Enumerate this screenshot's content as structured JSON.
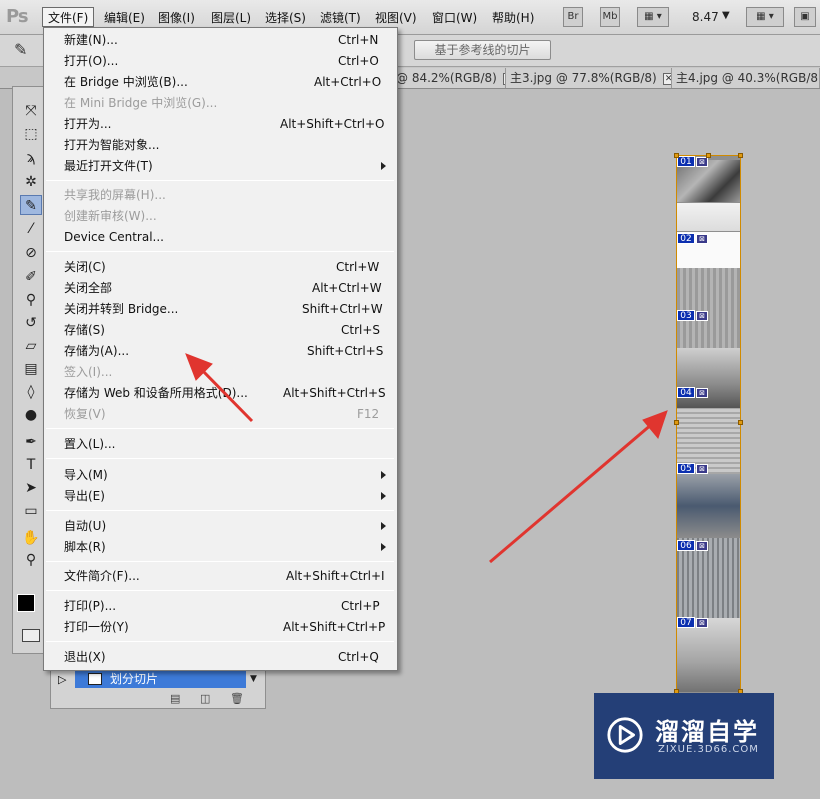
{
  "app": {
    "logo": "Ps"
  },
  "menubar": {
    "items": [
      {
        "label": "文件(F)"
      },
      {
        "label": "编辑(E)"
      },
      {
        "label": "图像(I)"
      },
      {
        "label": "图层(L)"
      },
      {
        "label": "选择(S)"
      },
      {
        "label": "滤镜(T)"
      },
      {
        "label": "视图(V)"
      },
      {
        "label": "窗口(W)"
      },
      {
        "label": "帮助(H)"
      }
    ],
    "bridge_btn": "Br",
    "minibridge_btn": "Mb",
    "zoom": "8.47"
  },
  "options": {
    "slice_from_guides": "基于参考线的切片"
  },
  "tabs": [
    {
      "label": "@ 84.2%(RGB/8)"
    },
    {
      "label": "主3.jpg @ 77.8%(RGB/8)"
    },
    {
      "label": "主4.jpg @ 40.3%(RGB/8)"
    }
  ],
  "file_menu": {
    "items": [
      {
        "label": "新建(N)...",
        "shortcut": "Ctrl+N"
      },
      {
        "label": "打开(O)...",
        "shortcut": "Ctrl+O"
      },
      {
        "label": "在 Bridge 中浏览(B)...",
        "shortcut": "Alt+Ctrl+O"
      },
      {
        "label": "在 Mini Bridge 中浏览(G)...",
        "shortcut": ""
      },
      {
        "label": "打开为...",
        "shortcut": "Alt+Shift+Ctrl+O"
      },
      {
        "label": "打开为智能对象...",
        "shortcut": ""
      },
      {
        "label": "最近打开文件(T)",
        "shortcut": ""
      },
      {
        "label": "共享我的屏幕(H)...",
        "shortcut": ""
      },
      {
        "label": "创建新审核(W)...",
        "shortcut": ""
      },
      {
        "label": "Device Central...",
        "shortcut": ""
      },
      {
        "label": "关闭(C)",
        "shortcut": "Ctrl+W"
      },
      {
        "label": "关闭全部",
        "shortcut": "Alt+Ctrl+W"
      },
      {
        "label": "关闭并转到 Bridge...",
        "shortcut": "Shift+Ctrl+W"
      },
      {
        "label": "存储(S)",
        "shortcut": "Ctrl+S"
      },
      {
        "label": "存储为(A)...",
        "shortcut": "Shift+Ctrl+S"
      },
      {
        "label": "签入(I)...",
        "shortcut": ""
      },
      {
        "label": "存储为 Web 和设备所用格式(D)...",
        "shortcut": "Alt+Shift+Ctrl+S"
      },
      {
        "label": "恢复(V)",
        "shortcut": "F12"
      },
      {
        "label": "置入(L)...",
        "shortcut": ""
      },
      {
        "label": "导入(M)",
        "shortcut": ""
      },
      {
        "label": "导出(E)",
        "shortcut": ""
      },
      {
        "label": "自动(U)",
        "shortcut": ""
      },
      {
        "label": "脚本(R)",
        "shortcut": ""
      },
      {
        "label": "文件简介(F)...",
        "shortcut": "Alt+Shift+Ctrl+I"
      },
      {
        "label": "打印(P)...",
        "shortcut": "Ctrl+P"
      },
      {
        "label": "打印一份(Y)",
        "shortcut": "Alt+Shift+Ctrl+P"
      },
      {
        "label": "退出(X)",
        "shortcut": "Ctrl+Q"
      }
    ]
  },
  "slices": [
    "01",
    "02",
    "03",
    "04",
    "05",
    "06",
    "07"
  ],
  "layers": {
    "active_layer": "划分切片"
  },
  "watermark": {
    "title": "溜溜自学",
    "subtitle": "ZIXUE.3D66.COM"
  },
  "colors": {
    "arrow": "#e0352f",
    "slice_label": "#0b2fb0",
    "watermark_bg": "#243f77"
  }
}
